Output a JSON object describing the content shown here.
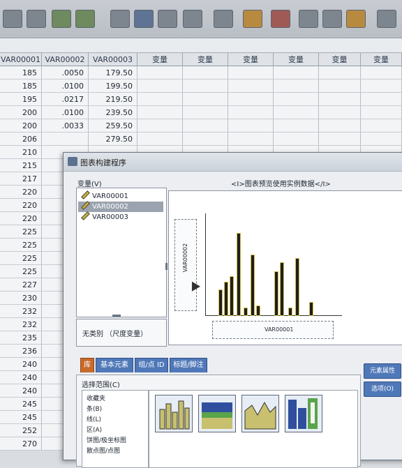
{
  "spreadsheet": {
    "headers": [
      "VAR00001",
      "VAR00002",
      "VAR00003",
      "变量",
      "变量",
      "变量",
      "变量",
      "变量",
      "变量"
    ],
    "rows": [
      [
        "185",
        ".0050",
        "179.50"
      ],
      [
        "185",
        ".0100",
        "199.50"
      ],
      [
        "195",
        ".0217",
        "219.50"
      ],
      [
        "200",
        ".0100",
        "239.50"
      ],
      [
        "200",
        ".0033",
        "259.50"
      ],
      [
        "206",
        "",
        "279.50"
      ],
      [
        "210",
        "",
        ""
      ],
      [
        "215",
        "",
        ""
      ],
      [
        "217",
        "",
        ""
      ],
      [
        "220",
        "",
        ""
      ],
      [
        "220",
        "",
        ""
      ],
      [
        "220",
        "",
        ""
      ],
      [
        "225",
        "",
        ""
      ],
      [
        "225",
        "",
        ""
      ],
      [
        "225",
        "",
        ""
      ],
      [
        "225",
        "",
        ""
      ],
      [
        "227",
        "",
        ""
      ],
      [
        "230",
        "",
        ""
      ],
      [
        "232",
        "",
        ""
      ],
      [
        "232",
        "",
        ""
      ],
      [
        "235",
        "",
        ""
      ],
      [
        "236",
        "",
        ""
      ],
      [
        "240",
        "",
        ""
      ],
      [
        "240",
        "",
        ""
      ],
      [
        "240",
        "",
        ""
      ],
      [
        "245",
        "",
        ""
      ],
      [
        "245",
        "",
        ""
      ],
      [
        "252",
        "",
        ""
      ],
      [
        "270",
        "",
        ""
      ]
    ]
  },
  "dialog": {
    "title": "图表构建程序",
    "variables_label": "变量(V)",
    "variables": [
      "VAR00001",
      "VAR00002",
      "VAR00003"
    ],
    "selected_variable": "VAR00002",
    "no_case_text": "无类别 （尺度变量）",
    "preview_label": "<I>图表预览使用实例数据</I>",
    "x_axis_var": "VAR00001",
    "y_axis_var": "VAR00002",
    "tabs": [
      "库",
      "基本元素",
      "组/点 ID",
      "标题/脚注"
    ],
    "active_tab": "库",
    "select_from_label": "选择范围(C)",
    "gallery_types": [
      "收藏夹",
      "条(B)",
      "线(L)",
      "区(A)",
      "饼图/极坐标图",
      "散点图/点图"
    ],
    "side_buttons": [
      "元素属性",
      "选项(O)"
    ],
    "preview_bars": [
      0.28,
      0.36,
      0.42,
      0.9,
      0.08,
      0.66,
      0.1,
      0.48,
      0.58,
      0.08,
      0.62,
      0.14
    ]
  },
  "colors": {
    "tab_blue": "#4f78b8",
    "tab_active": "#c76a2c",
    "bar_outline": "#d2c04a"
  },
  "icons": {
    "variable": "ruler-pencil-icon",
    "dialog": "chart-builder-icon"
  }
}
